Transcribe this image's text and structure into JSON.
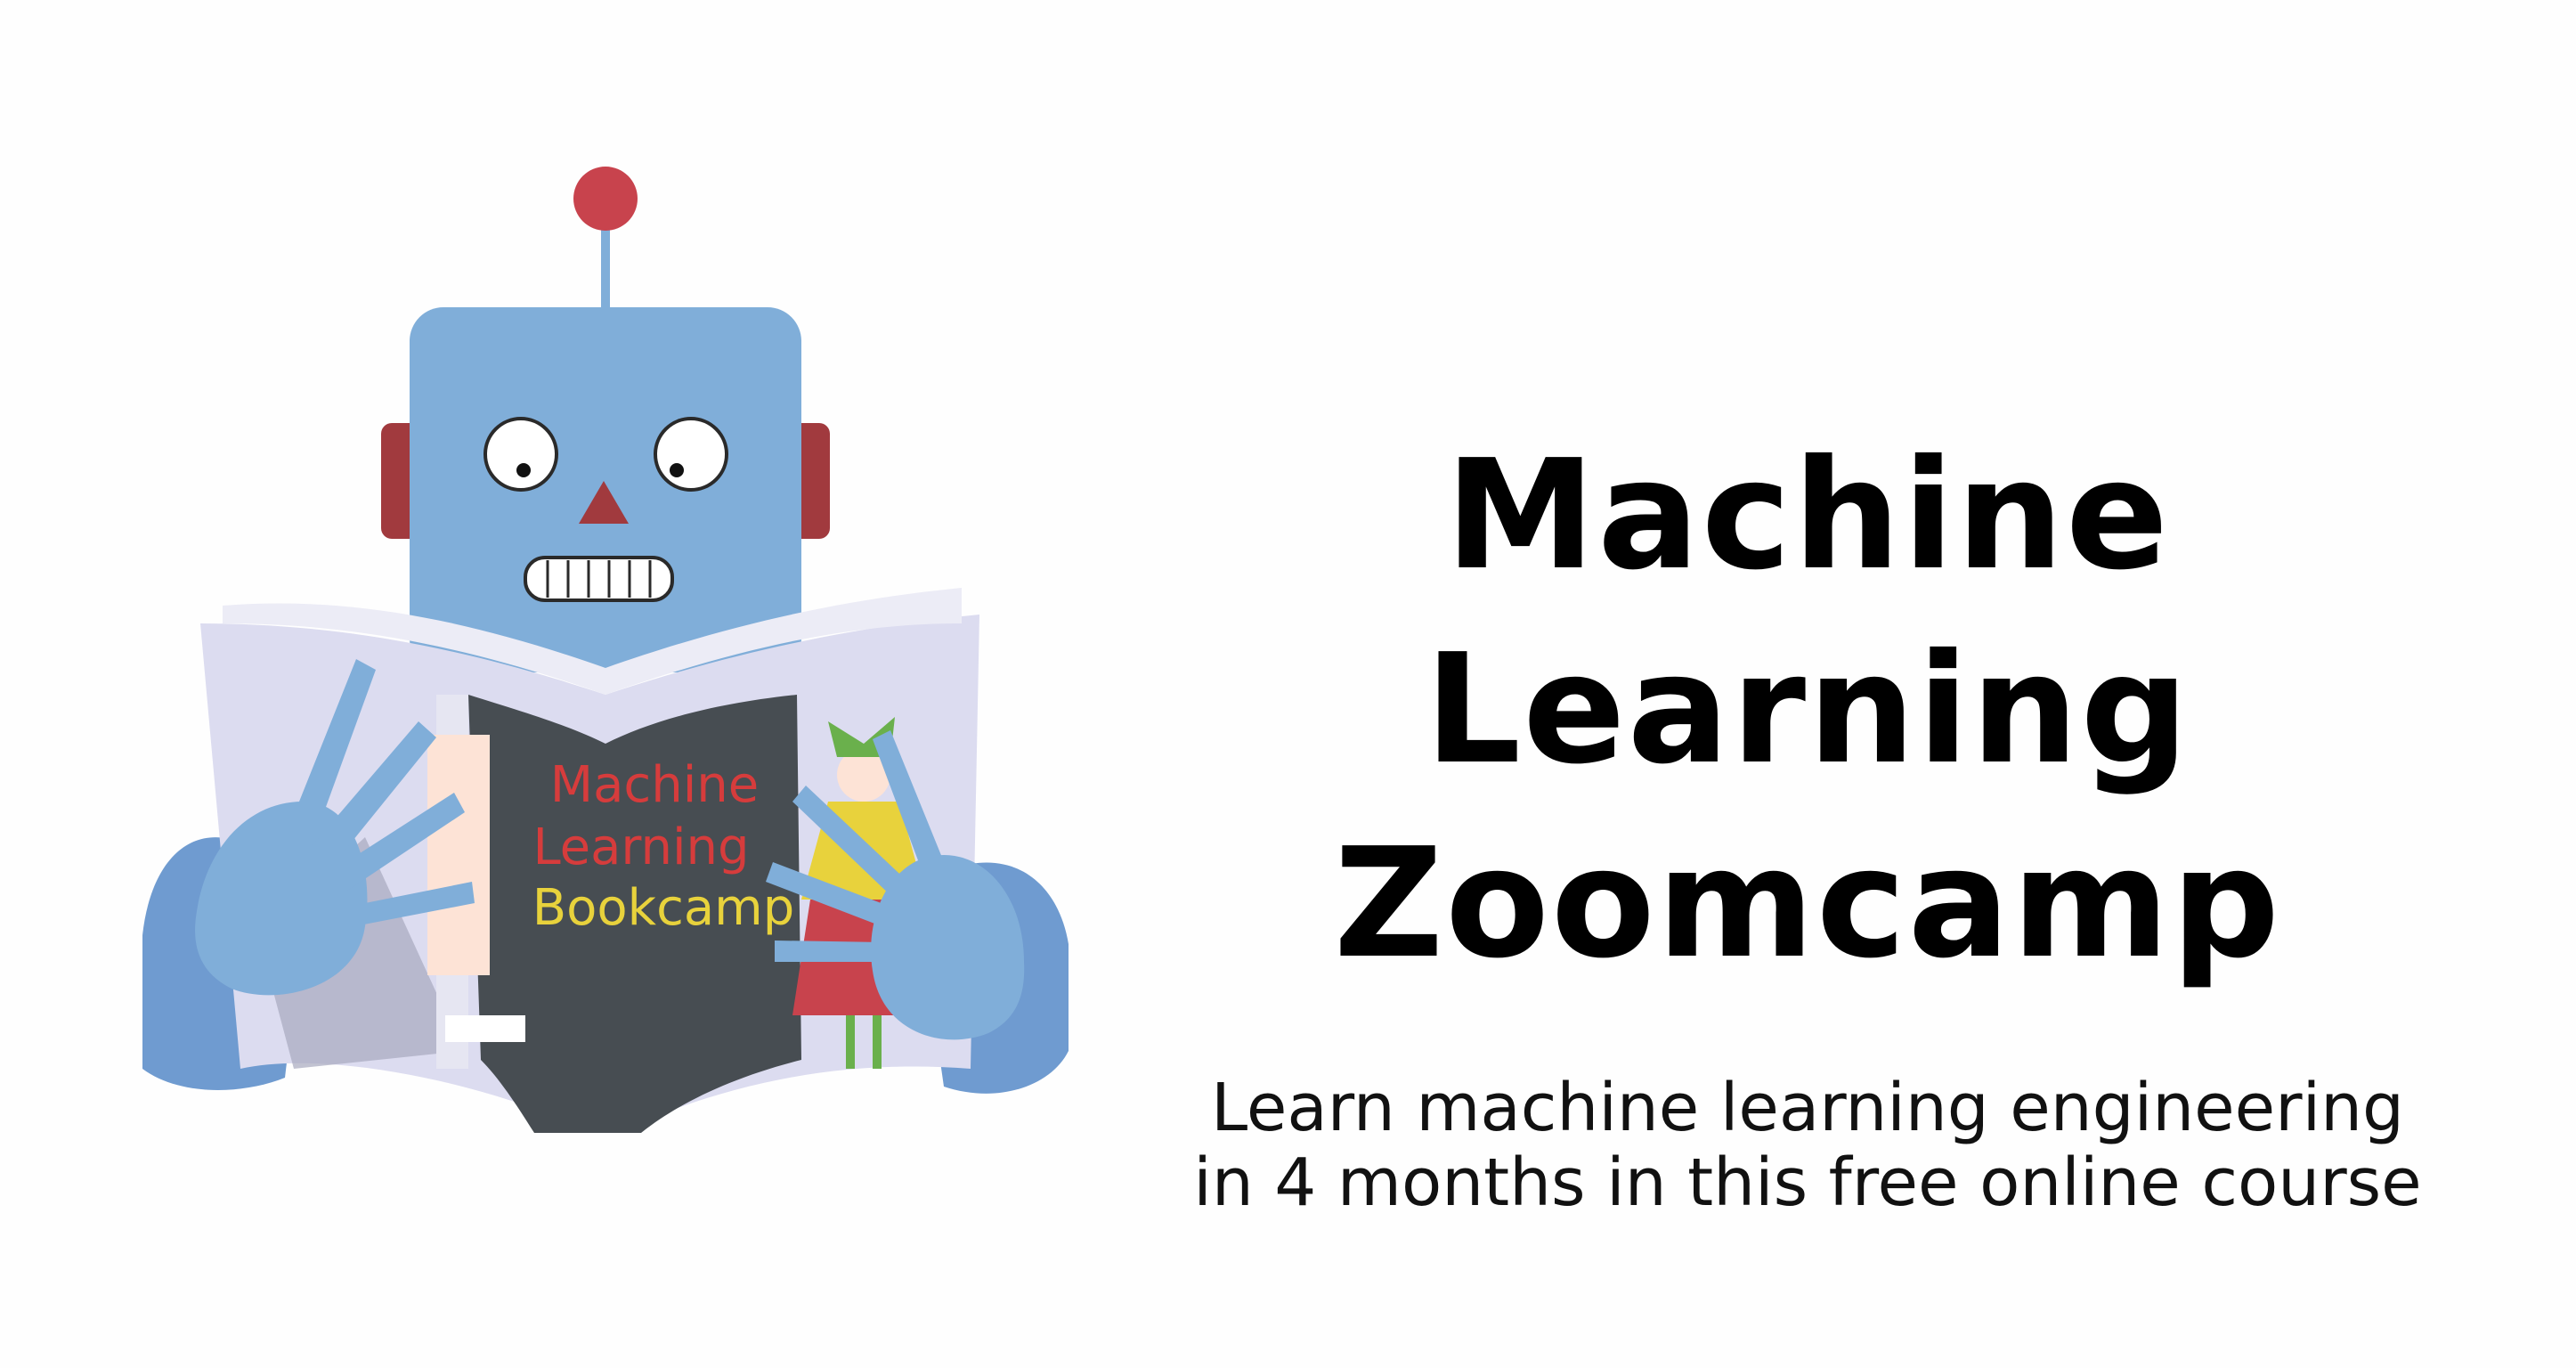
{
  "title": {
    "line1": "Machine Learning",
    "line2": "Zoomcamp"
  },
  "subtitle": {
    "line1": "Learn machine learning engineering",
    "line2": "in 4 months in this free online course"
  },
  "book_cover": {
    "line1": "Machine",
    "line2": "Learning",
    "line3": "Bookcamp"
  },
  "colors": {
    "robot_body": "#80aed9",
    "robot_hand": "#6f9bd0",
    "antenna_ball": "#c8434d",
    "ear": "#a13a3e",
    "book_cover": "#474d52",
    "page": "#dcdcf0",
    "title_text": "#000000",
    "cover_red": "#d63c3c",
    "cover_yellow": "#e8d23c"
  }
}
